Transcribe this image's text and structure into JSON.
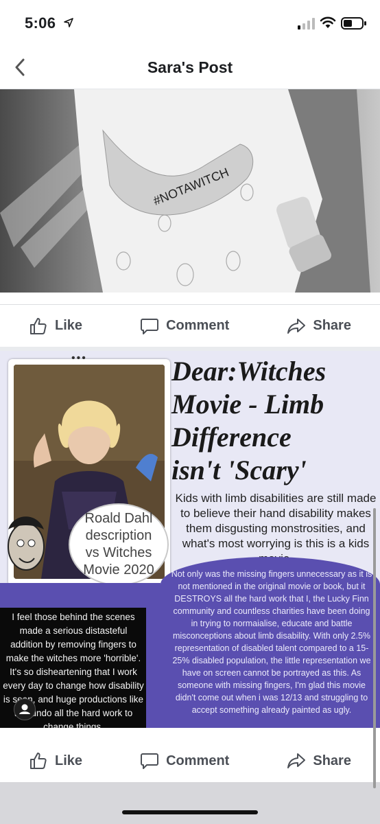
{
  "status_bar": {
    "time": "5:06"
  },
  "nav": {
    "title": "Sara's Post"
  },
  "photo_top": {
    "hand_text": "#NOTAWITCH"
  },
  "actions_top": {
    "like": "Like",
    "comment": "Comment",
    "share": "Share"
  },
  "infographic": {
    "headline": "Dear:Witches\nMovie - Limb\nDifference\nisn't 'Scary'",
    "subhead": "Kids with limb disabilities are still made to believe their hand disability makes them disgusting monstrosities, and what's most worrying is this is a kids movie.",
    "circle_label": "Roald Dahl\ndescription\nvs Witches\nMovie 2020",
    "purple_text": "Not only was the missing fingers unnecessary as it is not mentioned in the original movie or book, but it DESTROYS all the hard work that I, the Lucky Finn community and countless charities have been doing in trying to normaialise, educate and battle misconceptions about limb disability. With only 2.5% representation of disabled talent compared to a 15-25% disabled population, the little representation we have on screen cannot be portrayed as this. As someone with missing fingers, I'm glad this movie didn't come out when i was 12/13 and struggling to accept something already painted as ugly.",
    "black_text": "I feel those behind the scenes made a serious distasteful addition by removing fingers to make the witches more 'horrible'. It's so disheartening that I work every day to change how disability is seen, and huge productions like this undo all the hard work to change things."
  },
  "actions_bottom": {
    "like": "Like",
    "comment": "Comment",
    "share": "Share"
  },
  "colors": {
    "purple": "#5a4fb0",
    "action_text": "#4b4f56"
  }
}
